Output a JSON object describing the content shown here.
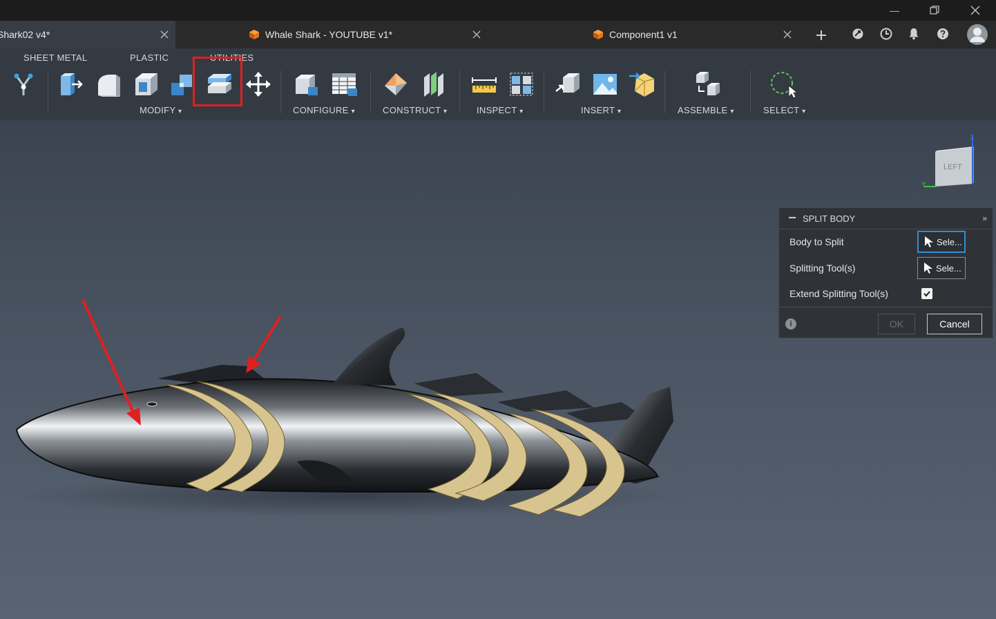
{
  "window": {
    "minimize_icon": "minimize-icon",
    "restore_icon": "restore-icon",
    "close_icon": "close-icon"
  },
  "tabs": [
    {
      "label": "Shark02 v4*",
      "active": true
    },
    {
      "label": "Whale Shark - YOUTUBE v1*",
      "active": false
    },
    {
      "label": "Component1 v1",
      "active": false
    }
  ],
  "toolbar": {
    "categories": [
      "SHEET METAL",
      "PLASTIC",
      "UTILITIES"
    ],
    "groups": {
      "modify": "MODIFY",
      "configure": "CONFIGURE",
      "construct": "CONSTRUCT",
      "inspect": "INSPECT",
      "insert": "INSERT",
      "assemble": "ASSEMBLE",
      "select": "SELECT"
    },
    "dropdown_glyph": "▾"
  },
  "viewcube": {
    "face": "LEFT",
    "axis_y": "Y",
    "axis_z": "Z"
  },
  "split_body": {
    "title": "SPLIT BODY",
    "body_label": "Body to Split",
    "tool_label": "Splitting Tool(s)",
    "extend_label": "Extend Splitting Tool(s)",
    "select_text": "Sele...",
    "extend_checked": true,
    "ok": "OK",
    "cancel": "Cancel"
  },
  "colors": {
    "accent": "#2c8fd6",
    "highlight": "#e0201f",
    "arrow": "#e0201f",
    "fin": "#d8c48e"
  }
}
